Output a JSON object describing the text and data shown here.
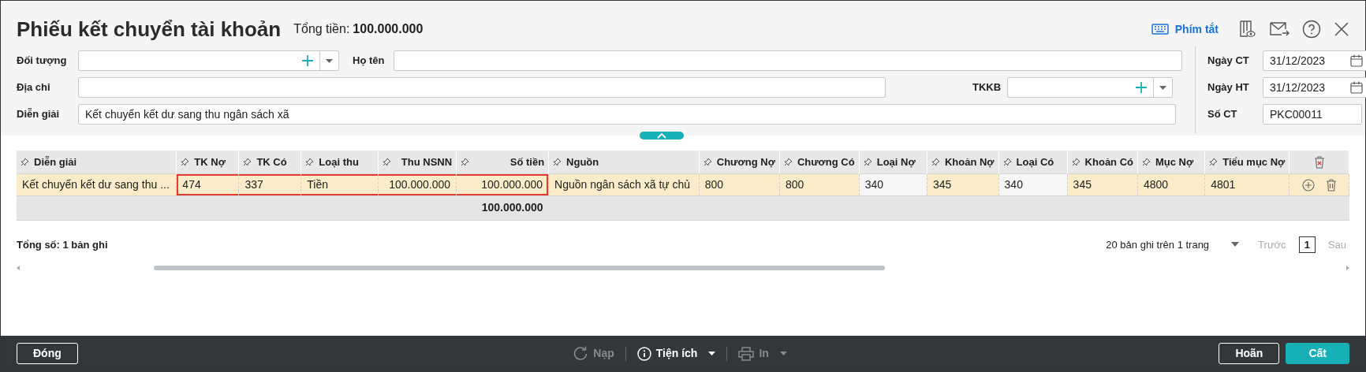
{
  "window": {
    "title": "Phiếu kết chuyển tài khoản",
    "total_label": "Tổng tiền:",
    "total_value": "100.000.000",
    "shortcut_link": "Phím tắt"
  },
  "form": {
    "rows": [
      {
        "fields": [
          {
            "label": "Đối tượng",
            "kind": "combo"
          },
          {
            "label": "Họ tên",
            "kind": "text"
          }
        ]
      },
      {
        "fields": [
          {
            "label": "Địa chỉ",
            "kind": "text"
          },
          {
            "label": "TKKB",
            "kind": "combo"
          }
        ]
      },
      {
        "fields": [
          {
            "label": "Diễn giải",
            "kind": "text",
            "value": "Kết chuyển kết dư sang thu ngân sách xã"
          }
        ]
      }
    ],
    "side_fields": [
      {
        "label": "Ngày CT",
        "kind": "date",
        "value": "31/12/2023"
      },
      {
        "label": "Ngày HT",
        "kind": "date",
        "value": "31/12/2023"
      },
      {
        "label": "Số CT",
        "kind": "text",
        "value": "PKC00011"
      }
    ]
  },
  "table": {
    "columns": [
      {
        "header": "Diễn giải",
        "kind": "text"
      },
      {
        "header": "TK Nợ",
        "kind": "text"
      },
      {
        "header": "TK Có",
        "kind": "text"
      },
      {
        "header": "Loại thu",
        "kind": "text"
      },
      {
        "header": "Thu NSNN",
        "kind": "number"
      },
      {
        "header": "Số tiền",
        "kind": "number",
        "total": "100.000.000"
      },
      {
        "header": "Nguồn",
        "kind": "text"
      },
      {
        "header": "Chương Nợ",
        "kind": "text"
      },
      {
        "header": "Chương Có",
        "kind": "text"
      },
      {
        "header": "Loại Nợ",
        "kind": "text"
      },
      {
        "header": "Khoản Nợ",
        "kind": "text"
      },
      {
        "header": "Loại Có",
        "kind": "text"
      },
      {
        "header": "Khoản Có",
        "kind": "text"
      },
      {
        "header": "Mục Nợ",
        "kind": "text"
      },
      {
        "header": "Tiểu mục Nợ",
        "kind": "text"
      }
    ],
    "rows": [
      {
        "selected": true,
        "cells": [
          {
            "text": "Kết chuyển kết dư sang thu ...",
            "plain": false
          },
          {
            "text": "474",
            "plain": false,
            "highlighted": true
          },
          {
            "text": "337",
            "plain": false,
            "highlighted": true
          },
          {
            "text": "Tiền",
            "plain": false,
            "highlighted": true
          },
          {
            "text": "100.000.000",
            "plain": false,
            "highlighted": true
          },
          {
            "text": "100.000.000",
            "plain": false,
            "highlighted": true
          },
          {
            "text": "Nguồn ngân sách xã tự chủ",
            "plain": false
          },
          {
            "text": "800",
            "plain": false
          },
          {
            "text": "800",
            "plain": false
          },
          {
            "text": "340",
            "plain": true
          },
          {
            "text": "345",
            "plain": false
          },
          {
            "text": "340",
            "plain": true
          },
          {
            "text": "345",
            "plain": false
          },
          {
            "text": "4800",
            "plain": false
          },
          {
            "text": "4801",
            "plain": false
          }
        ]
      }
    ]
  },
  "record_count": "Tổng số: 1 bản ghi",
  "pagination": {
    "page_size": "20 bản ghi trên 1 trang",
    "prev": "Trước",
    "prev_disabled": true,
    "page": "1",
    "next": "Sau",
    "next_disabled": true
  },
  "bottom_bar": {
    "left_button": "Đóng",
    "tools": [
      {
        "label": "Nạp",
        "kind": "refresh",
        "disabled": true,
        "caret": false
      },
      {
        "label": "Tiện ích",
        "kind": "info",
        "disabled": false,
        "caret": true
      },
      {
        "label": "In",
        "kind": "print",
        "disabled": true,
        "caret": true
      }
    ],
    "right_buttons": [
      {
        "label": "Hoãn",
        "primary": false
      },
      {
        "label": "Cất",
        "primary": true
      }
    ]
  }
}
